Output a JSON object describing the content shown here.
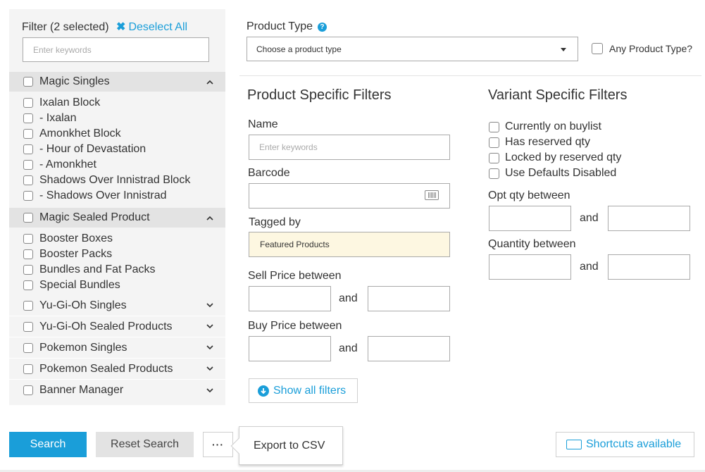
{
  "filter_panel": {
    "header_label": "Filter (2 selected)",
    "deselect_label": "Deselect All",
    "search_placeholder": "Enter keywords",
    "groups": [
      {
        "label": "Magic Singles",
        "expanded": true,
        "items": [
          "Ixalan Block",
          "- Ixalan",
          "Amonkhet Block",
          "- Hour of Devastation",
          "- Amonkhet",
          "Shadows Over Innistrad Block",
          "- Shadows Over Innistrad"
        ]
      },
      {
        "label": "Magic Sealed Product",
        "expanded": true,
        "items": [
          "Booster Boxes",
          "Booster Packs",
          "Bundles and Fat Packs",
          "Special Bundles"
        ]
      },
      {
        "label": "Yu-Gi-Oh Singles",
        "expanded": false
      },
      {
        "label": "Yu-Gi-Oh Sealed Products",
        "expanded": false
      },
      {
        "label": "Pokemon Singles",
        "expanded": false
      },
      {
        "label": "Pokemon Sealed Products",
        "expanded": false
      },
      {
        "label": "Banner Manager",
        "expanded": false
      }
    ]
  },
  "product_type": {
    "label": "Product Type",
    "help_icon": "question-circle-icon",
    "selected": "Choose a product type",
    "any_label": "Any Product Type?"
  },
  "product_filters": {
    "title": "Product Specific Filters",
    "name_label": "Name",
    "name_placeholder": "Enter keywords",
    "barcode_label": "Barcode",
    "barcode_icon": "barcode-icon",
    "tagged_label": "Tagged by",
    "tagged_value": "Featured Products",
    "sell_label": "Sell Price between",
    "buy_label": "Buy Price between",
    "and_text": "and",
    "show_all_label": "Show all filters"
  },
  "variant_filters": {
    "title": "Variant Specific Filters",
    "checkboxes": [
      "Currently on buylist",
      "Has reserved qty",
      "Locked by reserved qty",
      "Use Defaults Disabled"
    ],
    "opt_label": "Opt qty between",
    "qty_label": "Quantity between",
    "and_text": "and"
  },
  "footer": {
    "search_label": "Search",
    "reset_label": "Reset Search",
    "more_label": "···",
    "export_label": "Export to CSV",
    "shortcuts_label": "Shortcuts available"
  },
  "colors": {
    "accent": "#1a9ed9",
    "panel_bg": "#f4f4f4",
    "group_header_bg": "#e3e3e3",
    "tag_bg": "#fdf7e1"
  }
}
